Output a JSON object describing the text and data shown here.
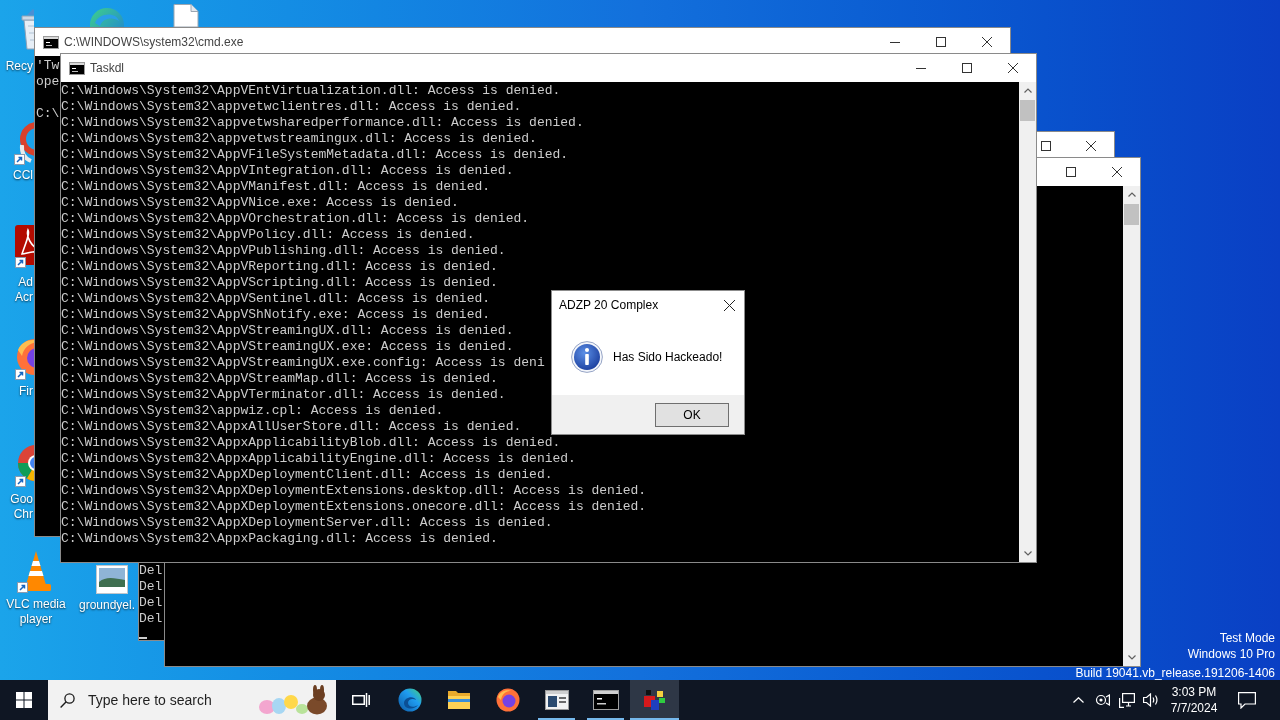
{
  "desktop_icons": [
    {
      "kind": "recycle",
      "label_lines": [
        "Recy"
      ]
    },
    {
      "kind": "browser"
    },
    {
      "kind": "document"
    },
    {
      "kind": "cleaner",
      "label_lines": [
        "CCl"
      ]
    },
    {
      "kind": "pdf",
      "label_lines": [
        "Ad",
        "Acr"
      ]
    },
    {
      "kind": "firefox",
      "label_lines": [
        "Fir"
      ]
    },
    {
      "kind": "chrome",
      "label_lines": [
        "Goo",
        "Chr"
      ]
    },
    {
      "kind": "vlc",
      "label_lines": [
        "VLC media",
        "player"
      ]
    },
    {
      "kind": "image",
      "label_lines": [
        "groundyel."
      ]
    }
  ],
  "cmd_window": {
    "title": "C:\\WINDOWS\\system32\\cmd.exe",
    "blocks": [
      [
        "'Tw",
        "ope"
      ],
      [
        "C:\\"
      ]
    ]
  },
  "taskdl_window": {
    "title": "Taskdl",
    "lines": [
      "C:\\Windows\\System32\\AppVEntVirtualization.dll: Access is denied.",
      "C:\\Windows\\System32\\appvetwclientres.dll: Access is denied.",
      "C:\\Windows\\System32\\appvetwsharedperformance.dll: Access is denied.",
      "C:\\Windows\\System32\\appvetwstreamingux.dll: Access is denied.",
      "C:\\Windows\\System32\\AppVFileSystemMetadata.dll: Access is denied.",
      "C:\\Windows\\System32\\AppVIntegration.dll: Access is denied.",
      "C:\\Windows\\System32\\AppVManifest.dll: Access is denied.",
      "C:\\Windows\\System32\\AppVNice.exe: Access is denied.",
      "C:\\Windows\\System32\\AppVOrchestration.dll: Access is denied.",
      "C:\\Windows\\System32\\AppVPolicy.dll: Access is denied.",
      "C:\\Windows\\System32\\AppVPublishing.dll: Access is denied.",
      "C:\\Windows\\System32\\AppVReporting.dll: Access is denied.",
      "C:\\Windows\\System32\\AppVScripting.dll: Access is denied.",
      "C:\\Windows\\System32\\AppVSentinel.dll: Access is denied.",
      "C:\\Windows\\System32\\AppVShNotify.exe: Access is denied.",
      "C:\\Windows\\System32\\AppVStreamingUX.dll: Access is denied.",
      "C:\\Windows\\System32\\AppVStreamingUX.exe: Access is denied.",
      "C:\\Windows\\System32\\AppVStreamingUX.exe.config: Access is deni",
      "C:\\Windows\\System32\\AppVStreamMap.dll: Access is denied.",
      "C:\\Windows\\System32\\AppVTerminator.dll: Access is denied.",
      "C:\\Windows\\System32\\appwiz.cpl: Access is denied.",
      "C:\\Windows\\System32\\AppxAllUserStore.dll: Access is denied.",
      "C:\\Windows\\System32\\AppxApplicabilityBlob.dll: Access is denied.",
      "C:\\Windows\\System32\\AppxApplicabilityEngine.dll: Access is denied.",
      "C:\\Windows\\System32\\AppXDeploymentClient.dll: Access is denied.",
      "C:\\Windows\\System32\\AppXDeploymentExtensions.desktop.dll: Access is denied.",
      "C:\\Windows\\System32\\AppXDeploymentExtensions.onecore.dll: Access is denied.",
      "C:\\Windows\\System32\\AppXDeploymentServer.dll: Access is denied.",
      "C:\\Windows\\System32\\AppxPackaging.dll: Access is denied."
    ]
  },
  "console_window": {
    "lines": [
      "Del",
      "Del",
      "Del",
      "Del"
    ]
  },
  "dialog": {
    "title": "ADZP 20 Complex",
    "message": "Has Sido Hackeado!",
    "buttons": [
      "OK"
    ]
  },
  "os_notice": [
    "Test Mode",
    "Windows 10 Pro",
    "Build 19041.vb_release.191206-1406"
  ],
  "taskbar": {
    "search": {
      "placeholder": "Type here to search"
    },
    "apps": [
      {
        "kind": "edge",
        "running": false,
        "selected": false
      },
      {
        "kind": "explorer",
        "running": false,
        "selected": false
      },
      {
        "kind": "firefox",
        "running": false,
        "selected": false
      },
      {
        "kind": "viewer",
        "running": true,
        "selected": false
      },
      {
        "kind": "terminal",
        "running": true,
        "selected": false
      },
      {
        "kind": "taskdl",
        "running": true,
        "selected": true
      }
    ],
    "clock": {
      "time": "3:03 PM",
      "date": "7/7/2024"
    }
  }
}
